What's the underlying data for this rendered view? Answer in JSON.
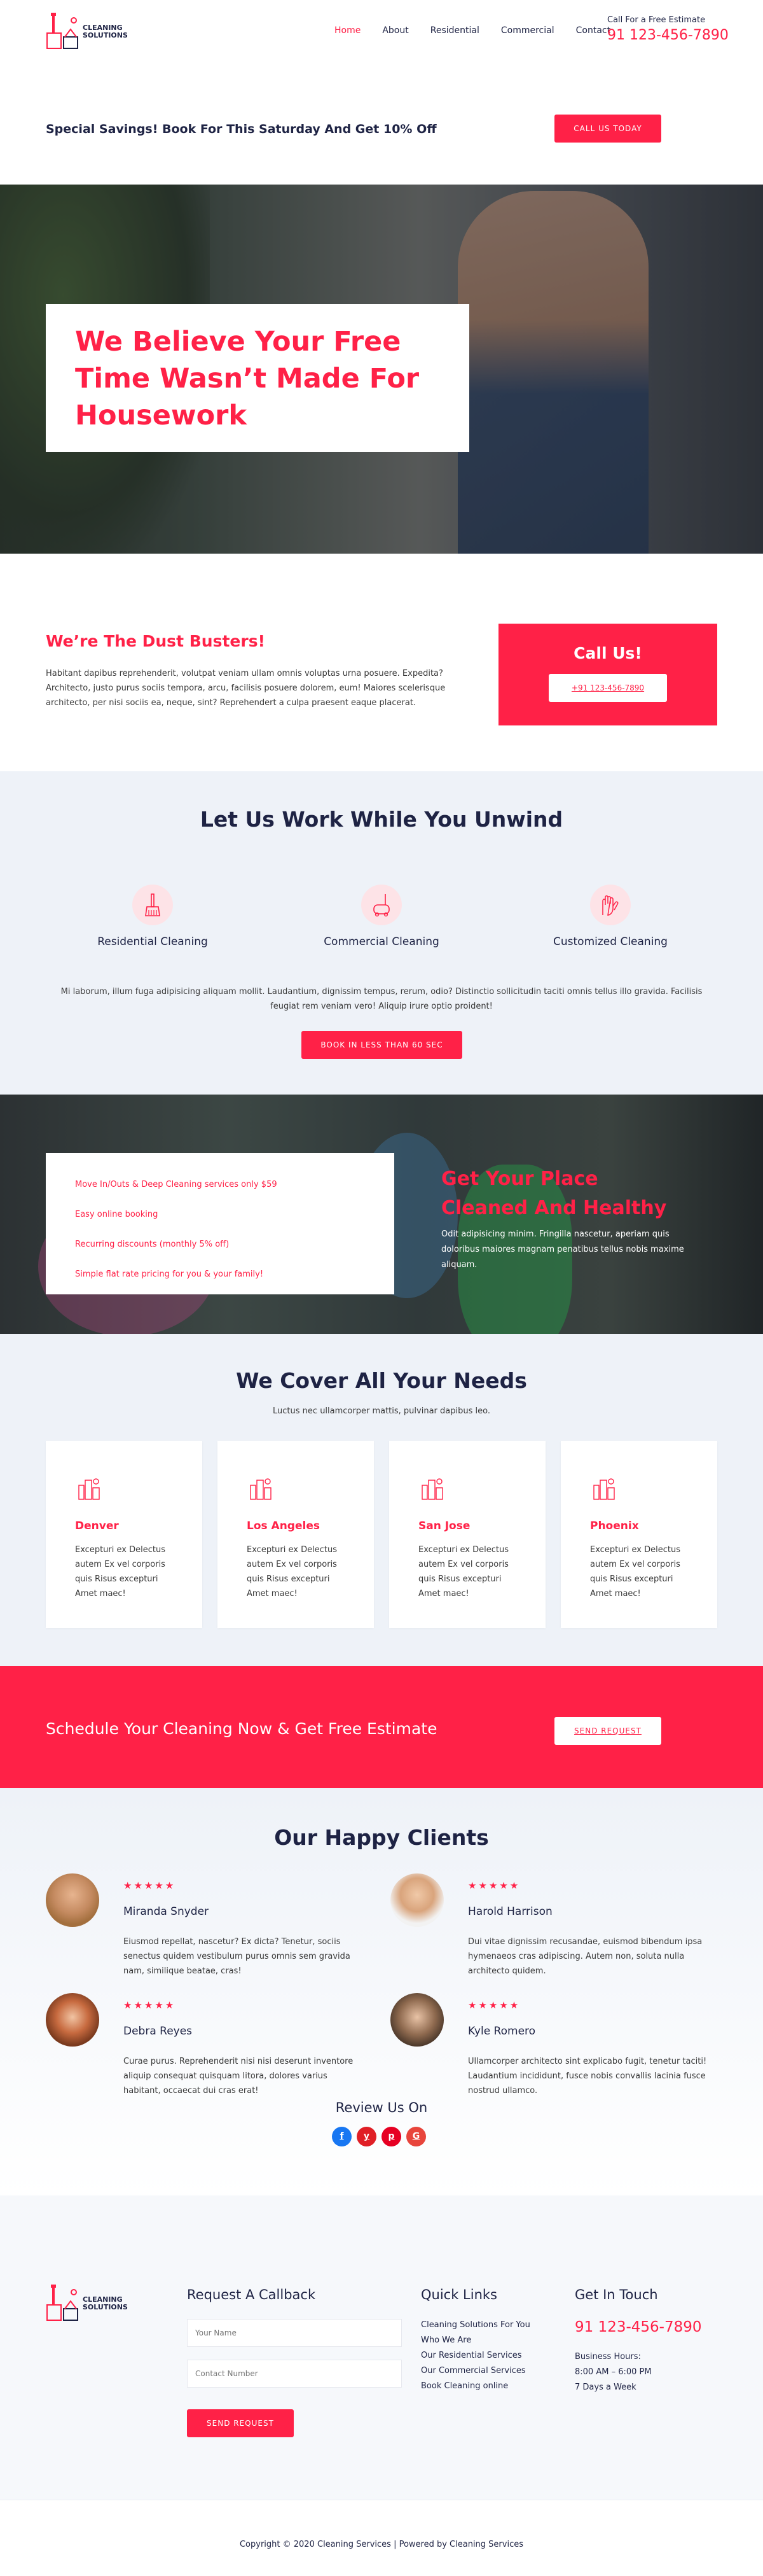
{
  "brand": {
    "line1": "CLEANING",
    "line2": "SOLUTIONS",
    "color": "#ff2147",
    "dark": "#1e2344"
  },
  "nav": [
    {
      "label": "Home",
      "active": true
    },
    {
      "label": "About"
    },
    {
      "label": "Residential"
    },
    {
      "label": "Commercial"
    },
    {
      "label": "Contact"
    }
  ],
  "header": {
    "estimate_label": "Call For a Free Estimate",
    "phone": "91 123-456-7890"
  },
  "promo": {
    "text": "Special Savings! Book For This Saturday And Get 10% Off",
    "button": "CALL US TODAY"
  },
  "hero": {
    "title": "We Believe Your Free Time Wasn’t Made For Housework"
  },
  "about": {
    "title": "We’re The Dust Busters!",
    "text": "Habitant dapibus reprehenderit, volutpat veniam ullam omnis voluptas urna posuere. Expedita? Architecto, justo purus sociis tempora, arcu, facilisis posuere dolorem, eum! Maiores scelerisque architecto, per nisi sociis ea, neque, sint? Reprehendert a culpa praesent eaque placerat.",
    "call_title": "Call Us!",
    "call_button": "+91 123-456-7890"
  },
  "services": {
    "title": "Let Us Work While You Unwind",
    "items": [
      {
        "label": "Residential Cleaning",
        "icon": "broom-icon"
      },
      {
        "label": "Commercial Cleaning",
        "icon": "vacuum-icon"
      },
      {
        "label": "Customized Cleaning",
        "icon": "gloves-icon"
      }
    ],
    "description": "Mi laborum, illum fuga adipisicing aliquam mollit. Laudantium, dignissim tempus, rerum, odio? Distinctio sollicitudin taciti omnis tellus illo gravida. Facilisis feugiat rem veniam vero! Aliquip irure optio proident!",
    "button": "BOOK IN LESS THAN 60 SEC"
  },
  "features": {
    "items": [
      "Move In/Outs & Deep Cleaning services only $59",
      "Easy online booking",
      "Recurring discounts (monthly 5% off)",
      "Simple flat rate pricing for you & your family!"
    ],
    "title_line1": "Get Your Place",
    "title_line2": "Cleaned And Healthy",
    "text": "Odit adipisicing minim. Fringilla nascetur, aperiam quis doloribus maiores magnam penatibus tellus nobis maxime aliquam."
  },
  "cover": {
    "title": "We Cover All Your Needs",
    "subtitle": "Luctus nec ullamcorper mattis, pulvinar dapibus leo.",
    "cities": [
      {
        "name": "Denver",
        "text": "Excepturi ex Delectus autem Ex vel corporis quis Risus excepturi Amet maec!"
      },
      {
        "name": "Los Angeles",
        "text": "Excepturi ex Delectus autem Ex vel corporis quis Risus excepturi Amet maec!"
      },
      {
        "name": "San Jose",
        "text": "Excepturi ex Delectus autem Ex vel corporis quis Risus excepturi Amet maec!"
      },
      {
        "name": "Phoenix",
        "text": "Excepturi ex Delectus autem Ex vel corporis quis Risus excepturi Amet maec!"
      }
    ]
  },
  "schedule": {
    "text": "Schedule Your Cleaning Now & Get Free Estimate",
    "button": "SEND REQUEST"
  },
  "clients": {
    "title": "Our Happy Clients",
    "reviews": [
      {
        "name": "Miranda Snyder",
        "stars": "★★★★★",
        "rating": 5,
        "text": "Eiusmod repellat, nascetur? Ex dicta? Tenetur, sociis senectus quidem vestibulum purus omnis sem gravida nam, similique beatae, cras!"
      },
      {
        "name": "Harold Harrison",
        "stars": "★★★★★",
        "rating": 5,
        "text": "Dui vitae dignissim recusandae, euismod bibendum ipsa hymenaeos cras adipiscing. Autem non, soluta nulla architecto quidem."
      },
      {
        "name": "Debra Reyes",
        "stars": "★★★★★",
        "rating": 5,
        "text": "Curae purus. Reprehenderit nisi nisi deserunt inventore aliquip consequat quisquam litora, dolores varius habitant, occaecat dui cras erat!"
      },
      {
        "name": "Kyle Romero",
        "stars": "★★★★★",
        "rating": 5,
        "text": "Ullamcorper architecto sint explicabo fugit, tenetur taciti! Laudantium incididunt, fusce nobis convallis lacinia fusce nostrud ullamco."
      }
    ],
    "review_us": "Review Us On",
    "socials": [
      {
        "name": "facebook-icon",
        "glyph": "f",
        "color": "#1877f2"
      },
      {
        "name": "yelp-icon",
        "glyph": "y",
        "color": "#e01f26"
      },
      {
        "name": "pinterest-icon",
        "glyph": "p",
        "color": "#e60023"
      },
      {
        "name": "google-icon",
        "glyph": "G",
        "color": "#e8453c"
      }
    ]
  },
  "footer": {
    "callback_title": "Request A Callback",
    "name_placeholder": "Your Name",
    "number_placeholder": "Contact Number",
    "button": "SEND REQUEST",
    "links_title": "Quick Links",
    "links": [
      "Cleaning Solutions For You",
      "Who We Are",
      "Our Residential Services",
      "Our Commercial Services",
      "Book Cleaning online"
    ],
    "touch_title": "Get In Touch",
    "phone": "91 123-456-7890",
    "hours_label": "Business Hours:",
    "hours": "8:00 AM – 6:00 PM",
    "days": "7 Days a Week",
    "copyright": "Copyright © 2020 Cleaning Services | Powered by Cleaning Services"
  }
}
